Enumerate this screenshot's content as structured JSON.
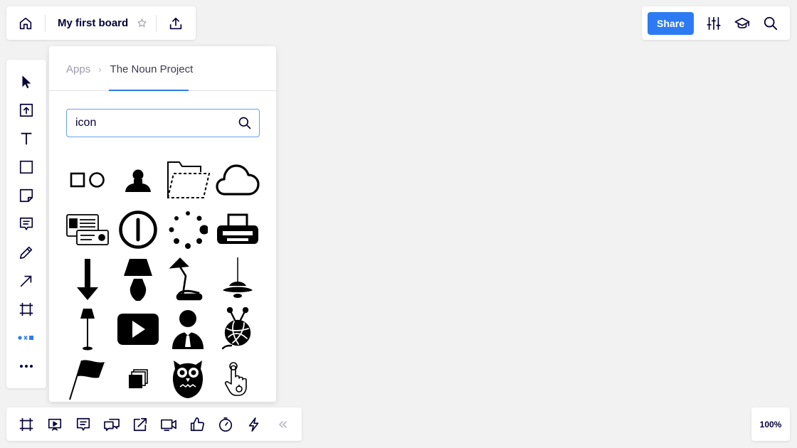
{
  "header": {
    "board_title": "My first board",
    "share_label": "Share"
  },
  "apps_panel": {
    "breadcrumb": [
      "Apps",
      "The Noun Project"
    ],
    "breadcrumb_separator": "›",
    "search": {
      "value": "icon"
    },
    "icon_results": [
      "square-and-circle-icon",
      "person-bust-icon",
      "dashed-folder-icon",
      "cloud-icon",
      "id-card-icon",
      "power-button-icon",
      "loading-dots-icon",
      "printer-icon",
      "arrow-down-icon",
      "table-lamp-icon",
      "desk-lamp-icon",
      "pendant-lamp-icon",
      "floor-lamp-icon",
      "play-button-icon",
      "businessman-icon",
      "yarn-ball-icon",
      "flag-icon",
      "stacked-squares-icon",
      "owl-icon",
      "tap-gesture-icon"
    ]
  },
  "left_toolbar": {
    "tools": [
      "select-tool",
      "upload-tool",
      "text-tool",
      "shape-tool",
      "sticky-note-tool",
      "comment-tool",
      "pen-tool",
      "line-tool",
      "frame-tool",
      "apps-tool",
      "more-tool"
    ]
  },
  "bottom_toolbar": {
    "items": [
      "frames",
      "presentation",
      "comments",
      "chat",
      "share-screen",
      "video-call",
      "vote",
      "timer",
      "activity",
      "collapse"
    ]
  },
  "zoom_level": "100%",
  "colors": {
    "accent": "#2d7bf2",
    "canvas": "#f2f2f2",
    "ink": "#050038"
  }
}
